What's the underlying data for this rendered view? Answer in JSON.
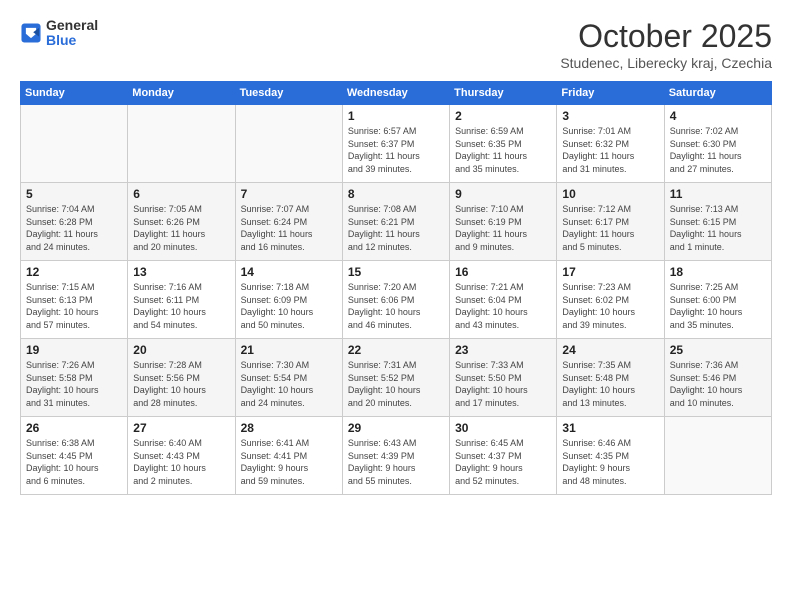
{
  "header": {
    "logo_general": "General",
    "logo_blue": "Blue",
    "month_title": "October 2025",
    "subtitle": "Studenec, Liberecky kraj, Czechia"
  },
  "days_of_week": [
    "Sunday",
    "Monday",
    "Tuesday",
    "Wednesday",
    "Thursday",
    "Friday",
    "Saturday"
  ],
  "weeks": [
    [
      {
        "day": "",
        "info": ""
      },
      {
        "day": "",
        "info": ""
      },
      {
        "day": "",
        "info": ""
      },
      {
        "day": "1",
        "info": "Sunrise: 6:57 AM\nSunset: 6:37 PM\nDaylight: 11 hours\nand 39 minutes."
      },
      {
        "day": "2",
        "info": "Sunrise: 6:59 AM\nSunset: 6:35 PM\nDaylight: 11 hours\nand 35 minutes."
      },
      {
        "day": "3",
        "info": "Sunrise: 7:01 AM\nSunset: 6:32 PM\nDaylight: 11 hours\nand 31 minutes."
      },
      {
        "day": "4",
        "info": "Sunrise: 7:02 AM\nSunset: 6:30 PM\nDaylight: 11 hours\nand 27 minutes."
      }
    ],
    [
      {
        "day": "5",
        "info": "Sunrise: 7:04 AM\nSunset: 6:28 PM\nDaylight: 11 hours\nand 24 minutes."
      },
      {
        "day": "6",
        "info": "Sunrise: 7:05 AM\nSunset: 6:26 PM\nDaylight: 11 hours\nand 20 minutes."
      },
      {
        "day": "7",
        "info": "Sunrise: 7:07 AM\nSunset: 6:24 PM\nDaylight: 11 hours\nand 16 minutes."
      },
      {
        "day": "8",
        "info": "Sunrise: 7:08 AM\nSunset: 6:21 PM\nDaylight: 11 hours\nand 12 minutes."
      },
      {
        "day": "9",
        "info": "Sunrise: 7:10 AM\nSunset: 6:19 PM\nDaylight: 11 hours\nand 9 minutes."
      },
      {
        "day": "10",
        "info": "Sunrise: 7:12 AM\nSunset: 6:17 PM\nDaylight: 11 hours\nand 5 minutes."
      },
      {
        "day": "11",
        "info": "Sunrise: 7:13 AM\nSunset: 6:15 PM\nDaylight: 11 hours\nand 1 minute."
      }
    ],
    [
      {
        "day": "12",
        "info": "Sunrise: 7:15 AM\nSunset: 6:13 PM\nDaylight: 10 hours\nand 57 minutes."
      },
      {
        "day": "13",
        "info": "Sunrise: 7:16 AM\nSunset: 6:11 PM\nDaylight: 10 hours\nand 54 minutes."
      },
      {
        "day": "14",
        "info": "Sunrise: 7:18 AM\nSunset: 6:09 PM\nDaylight: 10 hours\nand 50 minutes."
      },
      {
        "day": "15",
        "info": "Sunrise: 7:20 AM\nSunset: 6:06 PM\nDaylight: 10 hours\nand 46 minutes."
      },
      {
        "day": "16",
        "info": "Sunrise: 7:21 AM\nSunset: 6:04 PM\nDaylight: 10 hours\nand 43 minutes."
      },
      {
        "day": "17",
        "info": "Sunrise: 7:23 AM\nSunset: 6:02 PM\nDaylight: 10 hours\nand 39 minutes."
      },
      {
        "day": "18",
        "info": "Sunrise: 7:25 AM\nSunset: 6:00 PM\nDaylight: 10 hours\nand 35 minutes."
      }
    ],
    [
      {
        "day": "19",
        "info": "Sunrise: 7:26 AM\nSunset: 5:58 PM\nDaylight: 10 hours\nand 31 minutes."
      },
      {
        "day": "20",
        "info": "Sunrise: 7:28 AM\nSunset: 5:56 PM\nDaylight: 10 hours\nand 28 minutes."
      },
      {
        "day": "21",
        "info": "Sunrise: 7:30 AM\nSunset: 5:54 PM\nDaylight: 10 hours\nand 24 minutes."
      },
      {
        "day": "22",
        "info": "Sunrise: 7:31 AM\nSunset: 5:52 PM\nDaylight: 10 hours\nand 20 minutes."
      },
      {
        "day": "23",
        "info": "Sunrise: 7:33 AM\nSunset: 5:50 PM\nDaylight: 10 hours\nand 17 minutes."
      },
      {
        "day": "24",
        "info": "Sunrise: 7:35 AM\nSunset: 5:48 PM\nDaylight: 10 hours\nand 13 minutes."
      },
      {
        "day": "25",
        "info": "Sunrise: 7:36 AM\nSunset: 5:46 PM\nDaylight: 10 hours\nand 10 minutes."
      }
    ],
    [
      {
        "day": "26",
        "info": "Sunrise: 6:38 AM\nSunset: 4:45 PM\nDaylight: 10 hours\nand 6 minutes."
      },
      {
        "day": "27",
        "info": "Sunrise: 6:40 AM\nSunset: 4:43 PM\nDaylight: 10 hours\nand 2 minutes."
      },
      {
        "day": "28",
        "info": "Sunrise: 6:41 AM\nSunset: 4:41 PM\nDaylight: 9 hours\nand 59 minutes."
      },
      {
        "day": "29",
        "info": "Sunrise: 6:43 AM\nSunset: 4:39 PM\nDaylight: 9 hours\nand 55 minutes."
      },
      {
        "day": "30",
        "info": "Sunrise: 6:45 AM\nSunset: 4:37 PM\nDaylight: 9 hours\nand 52 minutes."
      },
      {
        "day": "31",
        "info": "Sunrise: 6:46 AM\nSunset: 4:35 PM\nDaylight: 9 hours\nand 48 minutes."
      },
      {
        "day": "",
        "info": ""
      }
    ]
  ]
}
